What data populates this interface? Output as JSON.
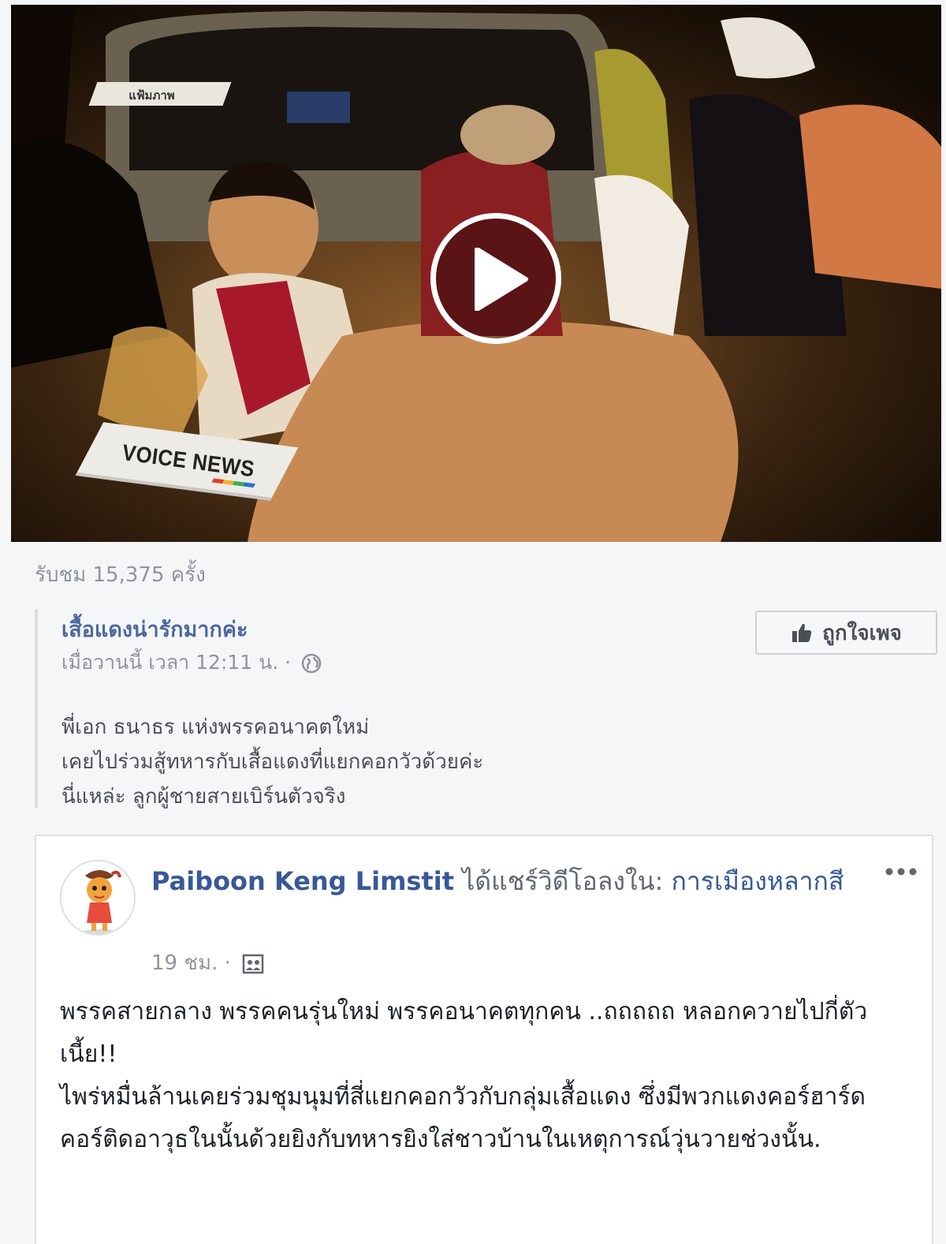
{
  "video": {
    "overlay_top_text": "แฟ้มภาพ",
    "channel_label": "VOICE NEWS"
  },
  "views": "รับชม 15,375 ครั้ง",
  "quote": {
    "page_name": "เสื้อแดงน่ารักมากค่ะ",
    "time": "เมื่อวานนี้ เวลา 12:11 น. ·",
    "like_page_label": "ถูกใจเพจ",
    "lines": [
      "พี่เอก ธนาธร แห่งพรรคอนาคตใหม่",
      "เคยไปร่วมสู้ทหารกับเสื้อแดงที่แยกคอกวัวด้วยค่ะ",
      "นี่แหล่ะ ลูกผู้ชายสายเบิร์นตัวจริง"
    ]
  },
  "shared_post": {
    "author": "Paiboon Keng Limstit",
    "action": " ได้แชร์วิดีโอลงใน: ",
    "group": "การเมืองหลากสี",
    "time": "19 ชม. ·",
    "body": "พรรคสายกลาง พรรคคนรุ่นใหม่ พรรคอนาคตทุกคน ..ถถถถถ หลอกควายไปกี่ตัวเนี้ย!!\nไพร่หมื่นล้านเคยร่วมชุมนุมที่สี่แยกคอกวัวกับกลุ่มเสื้อแดง ซึ่งมีพวกแดงคอร์ฮาร์ดคอร์ติดอาวุธในนั้นด้วยยิงกับทหารยิงใส่ชาวบ้านในเหตุการณ์วุ่นวายช่วงนั้น."
  },
  "icons": {
    "play": "play-icon",
    "globe": "globe-icon",
    "like": "thumbs-up-icon",
    "group": "group-icon",
    "more": "more-icon"
  }
}
